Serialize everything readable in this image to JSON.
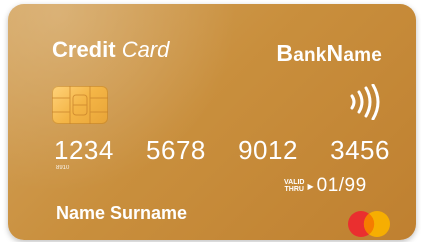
{
  "card": {
    "title_bold": "Credit",
    "title_italic": "Card",
    "bank_b": "B",
    "bank_ank": "ank",
    "bank_n": "N",
    "bank_ame": "ame",
    "number_groups": [
      "1234",
      "5678",
      "9012",
      "3456"
    ],
    "sub_number": "8910",
    "valid_line1": "VALID",
    "valid_line2": "THRU",
    "expiry": "01/99",
    "holder_name": "Name Surname"
  },
  "colors": {
    "card_gold": "#c98f3d",
    "chip": "#f4b546",
    "logo_red": "#ea2f2f",
    "logo_yellow": "#f9b000"
  },
  "icons": {
    "chip": "emv-chip-icon",
    "contactless": "contactless-icon",
    "network": "card-network-logo"
  }
}
